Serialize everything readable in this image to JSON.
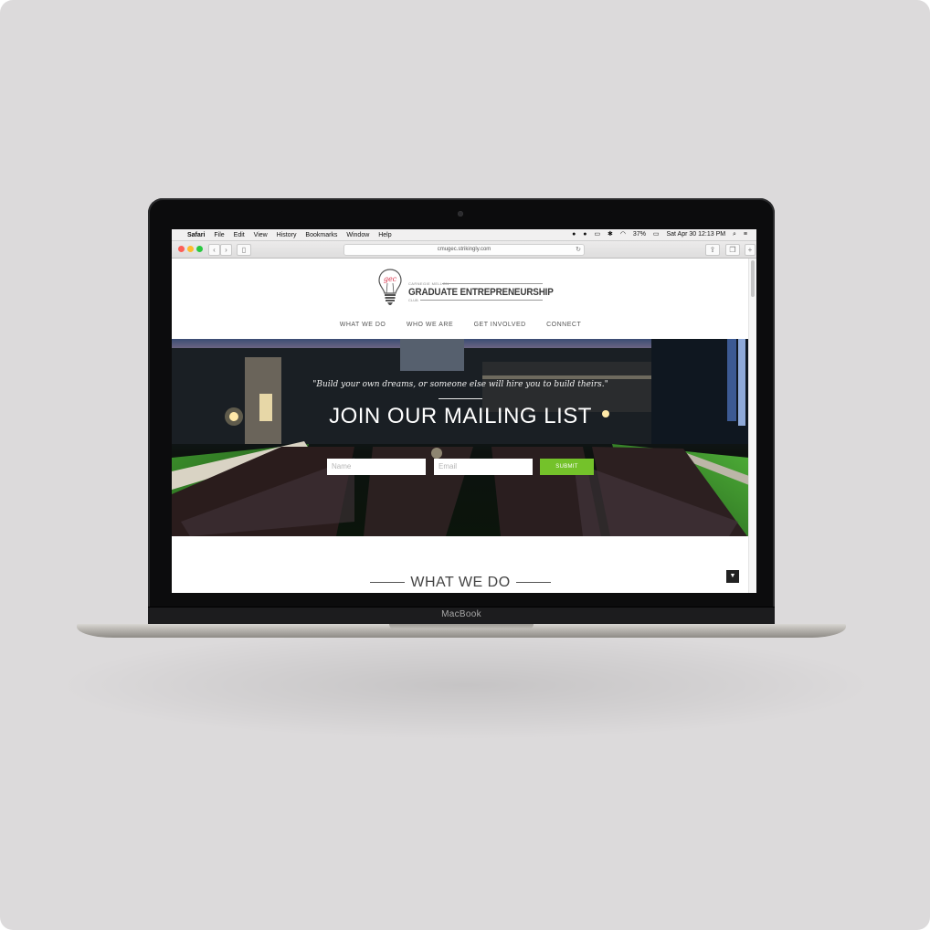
{
  "device": {
    "brand": "MacBook"
  },
  "menubar": {
    "app": "Safari",
    "items": [
      "File",
      "Edit",
      "View",
      "History",
      "Bookmarks",
      "Window",
      "Help"
    ],
    "battery": "37%",
    "datetime": "Sat Apr 30  12:13 PM"
  },
  "browser": {
    "url": "cmugec.strikingly.com"
  },
  "site": {
    "logo": {
      "bulb_text": "gec",
      "small_text": "CARNEGIE MELLON",
      "title": "GRADUATE ENTREPRENEURSHIP",
      "sub_text": "CLUB"
    },
    "nav": [
      "WHAT WE DO",
      "WHO WE ARE",
      "GET INVOLVED",
      "CONNECT"
    ],
    "hero": {
      "quote": "\"Build your own dreams, or someone else will hire you to build theirs.\"",
      "title": "JOIN OUR MAILING LIST",
      "name_placeholder": "Name",
      "email_placeholder": "Email",
      "submit_label": "SUBMIT"
    },
    "section_title": "WHAT WE DO"
  },
  "colors": {
    "accent": "#74c22a",
    "logo_red": "#d6324a"
  },
  "icons": {
    "scroll_down": "down-arrow-icon",
    "apple": "apple-icon",
    "wifi": "wifi-icon",
    "search": "search-icon"
  }
}
